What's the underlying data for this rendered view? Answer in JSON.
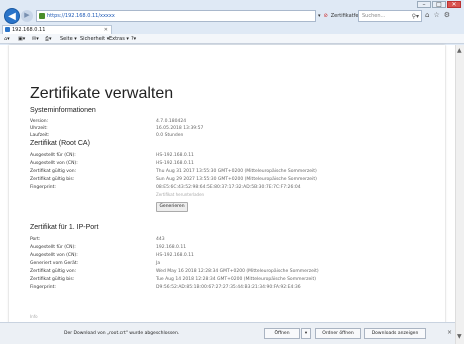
{
  "browser": {
    "address": "https://192.168.0.11/xxxxx",
    "cert_error": "Zertifikatfehler",
    "search_placeholder": "Suchen...",
    "tab_title": "192.168.0.11",
    "toolbar": {
      "menu1": "Seite ▾",
      "menu2": "Sicherheit ▾",
      "menu3": "Extras ▾",
      "menu4": "?▾"
    }
  },
  "page": {
    "title": "Zertifikate verwalten",
    "sys_heading": "Systeminformationen",
    "sys": [
      {
        "label": "Version:",
        "value": "4.7.0.180424"
      },
      {
        "label": "Uhrzeit:",
        "value": "16.05.2018 13:39:57"
      },
      {
        "label": "Laufzeit:",
        "value": "0.0 Stunden"
      }
    ],
    "root_heading": "Zertifikat (Root CA)",
    "root": [
      {
        "label": "Ausgestellt für (CN):",
        "value": "HS-192.168.0.11"
      },
      {
        "label": "Ausgestellt von (CN):",
        "value": "HS-192.168.0.11"
      },
      {
        "label": "Zertifikat gültig von:",
        "value": "Thu Aug 31 2017 13:55:30 GMT+0200 (Mitteleuropäische Sommerzeit)"
      },
      {
        "label": "Zertifikat gültig bis:",
        "value": "Sun Aug 29 2027 13:55:30 GMT+0200 (Mitteleuropäische Sommerzeit)"
      },
      {
        "label": "Fingerprint:",
        "value": "08:E5:6C:43:52:98:64:5E:80:37:17:32:AD:5B:30:7E:7C:F7:26:04"
      }
    ],
    "root_note": "Zertifikat herunterladen",
    "generate_button": "Generieren",
    "port_heading": "Zertifikat für 1. IP-Port",
    "port": [
      {
        "label": "Port:",
        "value": "443"
      },
      {
        "label": "Ausgestellt für (CN):",
        "value": "192.168.0.11"
      },
      {
        "label": "Ausgestellt von (CN):",
        "value": "HS-192.168.0.11"
      },
      {
        "label": "Generiert vom Gerät:",
        "value": "Ja"
      },
      {
        "label": "Zertifikat gültig von:",
        "value": "Wed May 16 2018 12:28:34 GMT+0200 (Mitteleuropäische Sommerzeit)"
      },
      {
        "label": "Zertifikat gültig bis:",
        "value": "Tue Aug 14 2018 12:28:34 GMT+0200 (Mitteleuropäische Sommerzeit)"
      },
      {
        "label": "Fingerprint:",
        "value": "D9:56:52:AD:85:1B:00:67:27:27:35:44:B3:21:34:90:FA:92:E4:36"
      }
    ],
    "more": "Info"
  },
  "download": {
    "text": "Der Download von „root.crt\" wurde abgeschlossen.",
    "open": "Öffnen",
    "open_arrow": "▾",
    "open_folder": "Ordner öffnen",
    "view_downloads": "Downloads anzeigen"
  }
}
